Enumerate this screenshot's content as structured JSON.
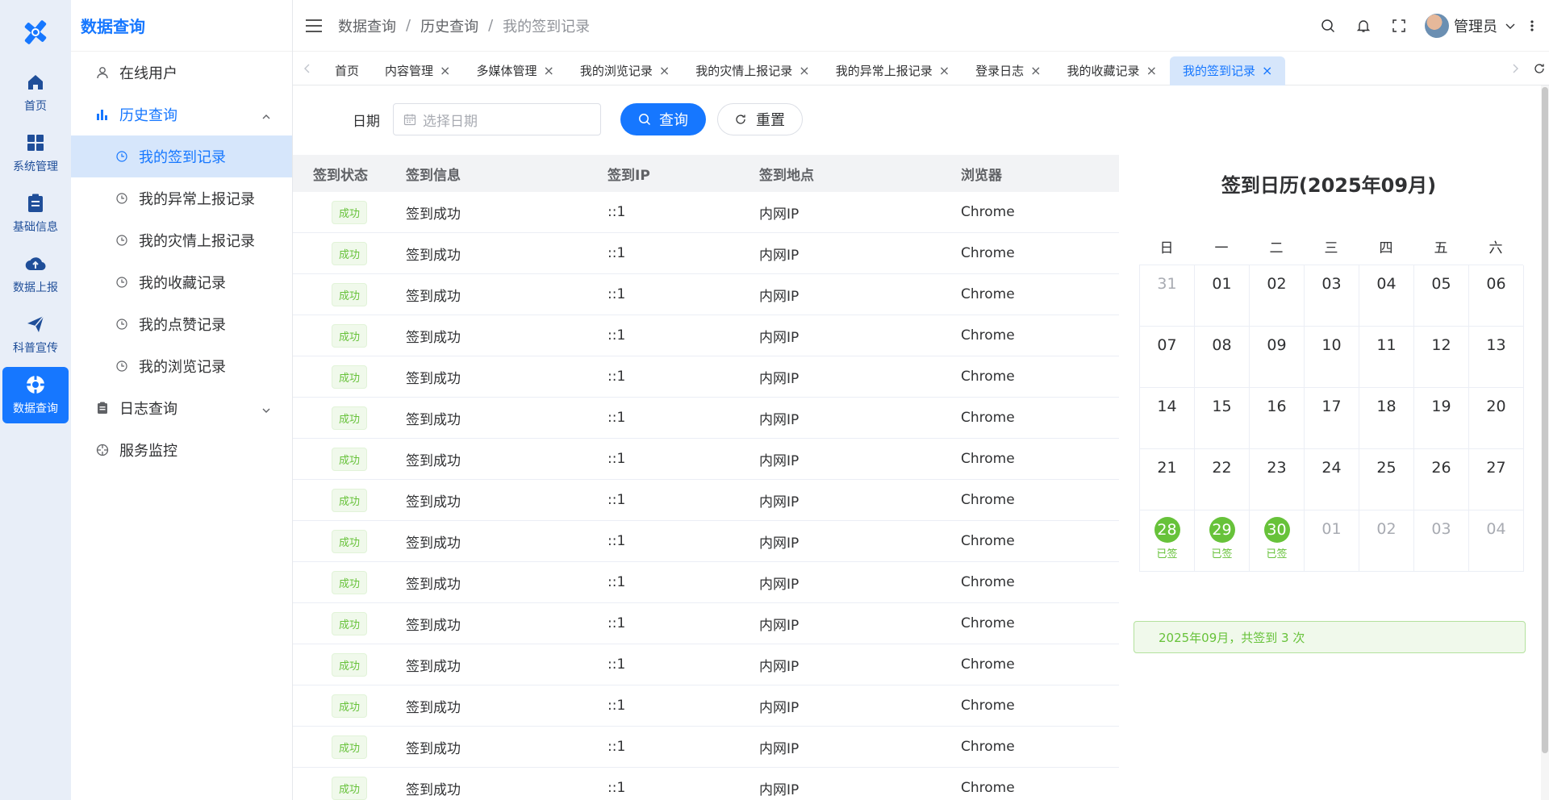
{
  "rail": {
    "items": [
      {
        "label": "首页",
        "icon": "home-icon"
      },
      {
        "label": "系统管理",
        "icon": "grid-icon"
      },
      {
        "label": "基础信息",
        "icon": "clipboard-icon"
      },
      {
        "label": "数据上报",
        "icon": "cloud-upload-icon"
      },
      {
        "label": "科普宣传",
        "icon": "paper-plane-icon"
      },
      {
        "label": "数据查询",
        "icon": "compass-icon",
        "active": true
      }
    ]
  },
  "subnav": {
    "title": "数据查询",
    "online_users": "在线用户",
    "history": "历史查询",
    "history_items": [
      "我的签到记录",
      "我的异常上报记录",
      "我的灾情上报记录",
      "我的收藏记录",
      "我的点赞记录",
      "我的浏览记录"
    ],
    "log_query": "日志查询",
    "service_monitor": "服务监控"
  },
  "header": {
    "breadcrumb": [
      "数据查询",
      "历史查询",
      "我的签到记录"
    ],
    "separator": "/",
    "username": "管理员"
  },
  "tabs": [
    {
      "label": "首页",
      "closable": false
    },
    {
      "label": "内容管理",
      "closable": true
    },
    {
      "label": "多媒体管理",
      "closable": true
    },
    {
      "label": "我的浏览记录",
      "closable": true
    },
    {
      "label": "我的灾情上报记录",
      "closable": true
    },
    {
      "label": "我的异常上报记录",
      "closable": true
    },
    {
      "label": "登录日志",
      "closable": true
    },
    {
      "label": "我的收藏记录",
      "closable": true
    },
    {
      "label": "我的签到记录",
      "closable": true,
      "active": true
    }
  ],
  "filter": {
    "date_label": "日期",
    "date_placeholder": "选择日期",
    "query_label": "查询",
    "reset_label": "重置"
  },
  "table": {
    "columns": [
      "签到状态",
      "签到信息",
      "签到IP",
      "签到地点",
      "浏览器"
    ],
    "rows": [
      [
        "成功",
        "签到成功",
        "::1",
        "内网IP",
        "Chrome"
      ],
      [
        "成功",
        "签到成功",
        "::1",
        "内网IP",
        "Chrome"
      ],
      [
        "成功",
        "签到成功",
        "::1",
        "内网IP",
        "Chrome"
      ],
      [
        "成功",
        "签到成功",
        "::1",
        "内网IP",
        "Chrome"
      ],
      [
        "成功",
        "签到成功",
        "::1",
        "内网IP",
        "Chrome"
      ],
      [
        "成功",
        "签到成功",
        "::1",
        "内网IP",
        "Chrome"
      ],
      [
        "成功",
        "签到成功",
        "::1",
        "内网IP",
        "Chrome"
      ],
      [
        "成功",
        "签到成功",
        "::1",
        "内网IP",
        "Chrome"
      ],
      [
        "成功",
        "签到成功",
        "::1",
        "内网IP",
        "Chrome"
      ],
      [
        "成功",
        "签到成功",
        "::1",
        "内网IP",
        "Chrome"
      ],
      [
        "成功",
        "签到成功",
        "::1",
        "内网IP",
        "Chrome"
      ],
      [
        "成功",
        "签到成功",
        "::1",
        "内网IP",
        "Chrome"
      ],
      [
        "成功",
        "签到成功",
        "::1",
        "内网IP",
        "Chrome"
      ],
      [
        "成功",
        "签到成功",
        "::1",
        "内网IP",
        "Chrome"
      ],
      [
        "成功",
        "签到成功",
        "::1",
        "内网IP",
        "Chrome"
      ]
    ]
  },
  "calendar": {
    "title": "签到日历(2025年09月)",
    "weekdays": [
      "日",
      "一",
      "二",
      "三",
      "四",
      "五",
      "六"
    ],
    "days": [
      {
        "d": "31",
        "other": true
      },
      {
        "d": "01"
      },
      {
        "d": "02"
      },
      {
        "d": "03"
      },
      {
        "d": "04"
      },
      {
        "d": "05"
      },
      {
        "d": "06"
      },
      {
        "d": "07"
      },
      {
        "d": "08"
      },
      {
        "d": "09"
      },
      {
        "d": "10"
      },
      {
        "d": "11"
      },
      {
        "d": "12"
      },
      {
        "d": "13"
      },
      {
        "d": "14"
      },
      {
        "d": "15"
      },
      {
        "d": "16"
      },
      {
        "d": "17"
      },
      {
        "d": "18"
      },
      {
        "d": "19"
      },
      {
        "d": "20"
      },
      {
        "d": "21"
      },
      {
        "d": "22"
      },
      {
        "d": "23"
      },
      {
        "d": "24"
      },
      {
        "d": "25"
      },
      {
        "d": "26"
      },
      {
        "d": "27"
      },
      {
        "d": "28",
        "signed": true
      },
      {
        "d": "29",
        "signed": true
      },
      {
        "d": "30",
        "signed": true
      },
      {
        "d": "01",
        "other": true
      },
      {
        "d": "02",
        "other": true
      },
      {
        "d": "03",
        "other": true
      },
      {
        "d": "04",
        "other": true
      }
    ],
    "signed_label": "已签",
    "summary": "2025年09月，共签到 3 次"
  },
  "colors": {
    "primary": "#1677ff",
    "success": "#67c23a",
    "active_bg": "#d6e6fb",
    "rail_bg": "#e8eef8"
  }
}
